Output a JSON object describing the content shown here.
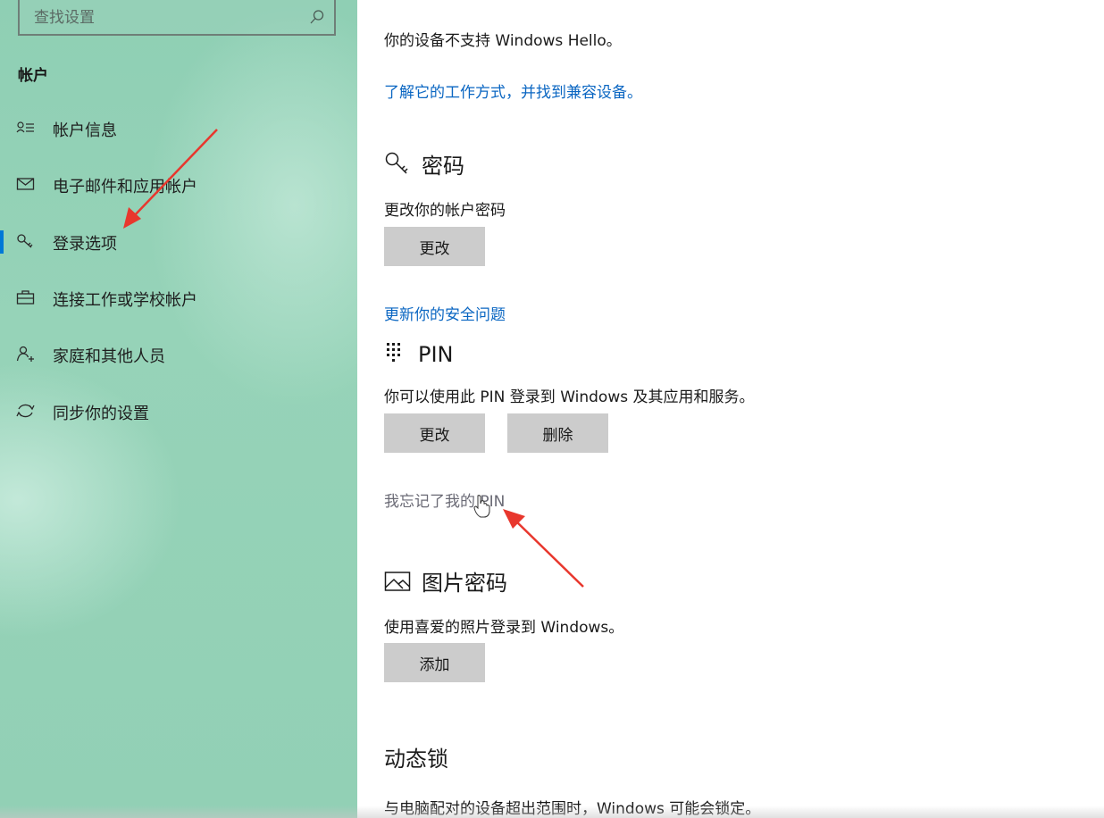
{
  "sidebar": {
    "search_placeholder": "查找设置",
    "heading": "帐户",
    "items": [
      {
        "label": "帐户信息",
        "icon": "account-info-icon"
      },
      {
        "label": "电子邮件和应用帐户",
        "icon": "mail-icon"
      },
      {
        "label": "登录选项",
        "icon": "key-icon",
        "selected": true
      },
      {
        "label": "连接工作或学校帐户",
        "icon": "briefcase-icon"
      },
      {
        "label": "家庭和其他人员",
        "icon": "add-person-icon"
      },
      {
        "label": "同步你的设置",
        "icon": "sync-icon"
      }
    ]
  },
  "main": {
    "hello_unsupported": "你的设备不支持 Windows Hello。",
    "hello_link": "了解它的工作方式，并找到兼容设备。",
    "password": {
      "title": "密码",
      "description": "更改你的帐户密码",
      "change_button": "更改",
      "security_link": "更新你的安全问题"
    },
    "pin": {
      "title": "PIN",
      "description": "你可以使用此 PIN 登录到 Windows 及其应用和服务。",
      "change_button": "更改",
      "remove_button": "删除",
      "forgot_link": "我忘记了我的 PIN"
    },
    "picture_password": {
      "title": "图片密码",
      "description": "使用喜爱的照片登录到 Windows。",
      "add_button": "添加"
    },
    "dynamic_lock": {
      "title": "动态锁",
      "description": "与电脑配对的设备超出范围时，Windows 可能会锁定。"
    }
  },
  "colors": {
    "sidebar_bg": "#92d0b5",
    "link": "#0a66c2",
    "button_bg": "#cccccc",
    "selection_accent": "#0078d7",
    "annotation_arrow": "#e8372d"
  }
}
